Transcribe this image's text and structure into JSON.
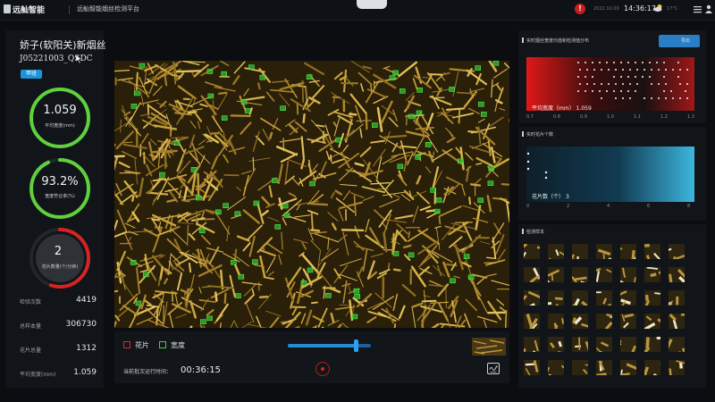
{
  "header": {
    "brand": "远舢智能",
    "platform_title": "远舢智能烟丝检测平台",
    "alert_label": "!",
    "date": "2022.10.09",
    "time": "14:36:17",
    "temperature": "17°C",
    "icons": [
      "logo-icon",
      "alert-icon",
      "weather-icon",
      "menu-icon",
      "user-icon"
    ]
  },
  "product": {
    "title": "娇子(软阳关)新烟丝",
    "code": "J05221003_QSDC",
    "status": "甲班"
  },
  "gauges": [
    {
      "value": "1.059",
      "label": "平均宽度(mm)",
      "color": "#5ed13c",
      "fraction": 1.0
    },
    {
      "value": "93.2%",
      "label": "宽度符合率(%)",
      "color": "#5ed13c",
      "fraction": 0.932
    },
    {
      "value": "2",
      "label": "花片数量(个/分钟)",
      "color": "#d62323",
      "fraction": 0.55
    }
  ],
  "stats": [
    {
      "label": "检验次数",
      "value": "4419"
    },
    {
      "label": "总样本量",
      "value": "306730"
    },
    {
      "label": "花片总量",
      "value": "1312"
    },
    {
      "label": "平均宽度(mm)",
      "value": "1.059"
    }
  ],
  "legend": {
    "flake": "花片",
    "width": "宽度",
    "flake_color": "#d62b2b",
    "width_color": "#3ed43e"
  },
  "slider": {
    "value_fraction": 0.8
  },
  "runtime": {
    "label": "当前批次运行时间：",
    "value": "00:36:15"
  },
  "panels": {
    "width_distribution": {
      "title": "实时烟丝宽度均值和检测值分布",
      "export": "导出",
      "caption_label": "平均宽度（mm）",
      "caption_value": "1.059"
    },
    "flake_count": {
      "title": "实时花片个数",
      "caption_label": "花片数（个）",
      "caption_value": "3"
    },
    "samples": {
      "title": "检测样本"
    }
  },
  "chart_data": [
    {
      "type": "scatter",
      "title": "实时烟丝宽度均值和检测值分布",
      "x_ticks": [
        "0.7",
        "0.8",
        "0.9",
        "1.0",
        "1.1",
        "1.2",
        "1.3"
      ],
      "xlim": [
        0.7,
        1.3
      ],
      "mean": 1.059
    },
    {
      "type": "bar",
      "title": "实时花片个数",
      "x_ticks": [
        "0",
        "2",
        "4",
        "6",
        "8"
      ],
      "xlim": [
        0,
        8
      ],
      "value": 3
    }
  ]
}
